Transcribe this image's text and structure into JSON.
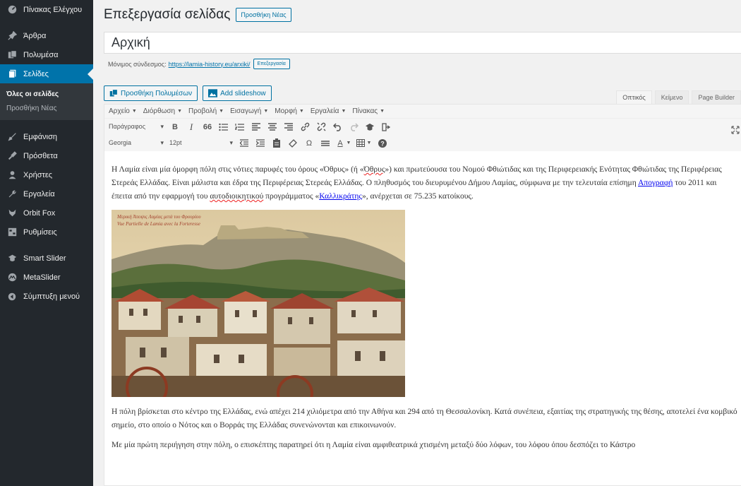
{
  "sidebar": {
    "items": [
      {
        "label": "Πίνακας Ελέγχου",
        "icon": "dashboard-icon"
      },
      {
        "label": "Άρθρα",
        "icon": "pin-icon"
      },
      {
        "label": "Πολυμέσα",
        "icon": "media-icon"
      },
      {
        "label": "Σελίδες",
        "icon": "pages-icon"
      },
      {
        "label": "Εμφάνιση",
        "icon": "appearance-icon"
      },
      {
        "label": "Πρόσθετα",
        "icon": "plugins-icon"
      },
      {
        "label": "Χρήστες",
        "icon": "users-icon"
      },
      {
        "label": "Εργαλεία",
        "icon": "tools-icon"
      },
      {
        "label": "Orbit Fox",
        "icon": "fox-icon"
      },
      {
        "label": "Ρυθμίσεις",
        "icon": "settings-icon"
      },
      {
        "label": "Smart Slider",
        "icon": "slider-icon"
      },
      {
        "label": "MetaSlider",
        "icon": "metaslider-icon"
      },
      {
        "label": "Σύμπτυξη μενού",
        "icon": "collapse-icon"
      }
    ],
    "submenu": [
      "Όλες οι σελίδες",
      "Προσθήκη Νέας"
    ]
  },
  "header": {
    "title": "Επεξεργασία σελίδας",
    "add_new": "Προσθήκη Νέας"
  },
  "post": {
    "title": "Αρχική",
    "permalink_label": "Μόνιμος σύνδεσμος:",
    "permalink_url": "https://lamia-history.eu/arxiki/",
    "edit_label": "Επεξεργασία"
  },
  "media": {
    "add_media": "Προσθήκη Πολυμέσων",
    "add_slideshow": "Add slideshow"
  },
  "editor_tabs": [
    "Οπτικός",
    "Κείμενο",
    "Page Builder"
  ],
  "menubar": [
    "Αρχείο",
    "Διόρθωση",
    "Προβολή",
    "Εισαγωγή",
    "Μορφή",
    "Εργαλεία",
    "Πίνακας"
  ],
  "toolbar": {
    "format": "Παράγραφος",
    "font": "Georgia",
    "size": "12pt",
    "bold": "B",
    "italic": "I",
    "quote": "66",
    "omega": "Ω",
    "text_color": "A"
  },
  "content": {
    "p1_a": "Η Λαμία είναι μία όμορφη πόλη στις νότιες παρυφές του όρους «Όθρυς» (ή «",
    "p1_b": "Όθρυς",
    "p1_c": "») και πρωτεύουσα του Νομού Φθιώτιδας και της Περιφερειακής Ενότητας Φθιώτιδας της Περιφέρειας Στερεάς Ελλάδας. Είναι μάλιστα και έδρα της Περιφέρειας Στερεάς Ελλάδας. Ο πληθυσμός του διευρυμένου Δήμου Λαμίας, σύμφωνα με την τελευταία επίσημη ",
    "p1_link1": "Απογραφή",
    "p1_d": " του 2011 και έπειτα από την εφαρμογή του ",
    "p1_e": "αυτοδιοικητικού",
    "p1_f": " προγράμματος «",
    "p1_link2": "Καλλικράτης",
    "p1_g": "», ανέρχεται σε 75.235 κατοίκους.",
    "photo_caption1": "Μερική Άποψις Λαμίας μετά του Φρουρίου",
    "photo_caption2": "Vue Partielle de Lamia avec la Forteresse",
    "p2": "Η πόλη βρίσκεται στο κέντρο της Ελλάδας, ενώ απέχει 214 χιλιόμετρα από την Αθήνα και 294 από τη Θεσσαλονίκη. Κατά συνέπεια, εξαιτίας της στρατηγικής της θέσης, αποτελεί ένα κομβικό σημείο, στο οποίο ο Νότος και ο Βορράς της Ελλάδας συνενώνονται και επικοινωνούν.",
    "p3": "Με μία πρώτη περιήγηση στην πόλη, ο επισκέπτης παρατηρεί ότι η Λαμία είναι αμφιθεατρικά χτισμένη μεταξύ δύο λόφων, του λόφου όπου δεσπόζει το Κάστρο"
  },
  "colors": {
    "sidebar_bg": "#23282d",
    "active": "#0073aa",
    "link": "#0073aa"
  }
}
